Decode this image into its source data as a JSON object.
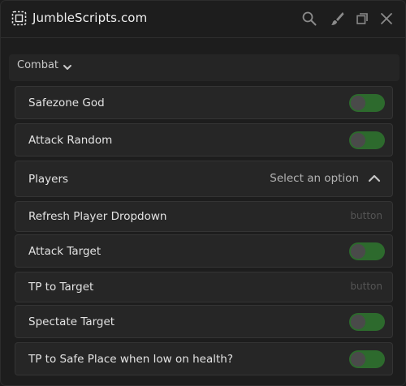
{
  "window": {
    "title": "JumbleScripts.com"
  },
  "toolbar": {
    "icons": [
      "search-icon",
      "brush-icon",
      "restore-icon",
      "close-icon"
    ]
  },
  "section": {
    "label": "Combat"
  },
  "rows": [
    {
      "label": "Safezone God",
      "type": "toggle"
    },
    {
      "label": "Attack Random",
      "type": "toggle"
    },
    {
      "label": "Players",
      "type": "dropdown",
      "value": "Select an option"
    },
    {
      "label": "Refresh Player Dropdown",
      "type": "button",
      "hint": "button"
    },
    {
      "label": "Attack Target",
      "type": "toggle"
    },
    {
      "label": "TP to Target",
      "type": "button",
      "hint": "button"
    },
    {
      "label": "Spectate Target",
      "type": "toggle"
    },
    {
      "label": "TP to Safe Place when low on health?",
      "type": "toggle"
    }
  ],
  "colors": {
    "toggle_track": "#2d6a2d",
    "toggle_knob": "#4a4a4a",
    "background": "#1d1d1d",
    "row": "#262626"
  }
}
